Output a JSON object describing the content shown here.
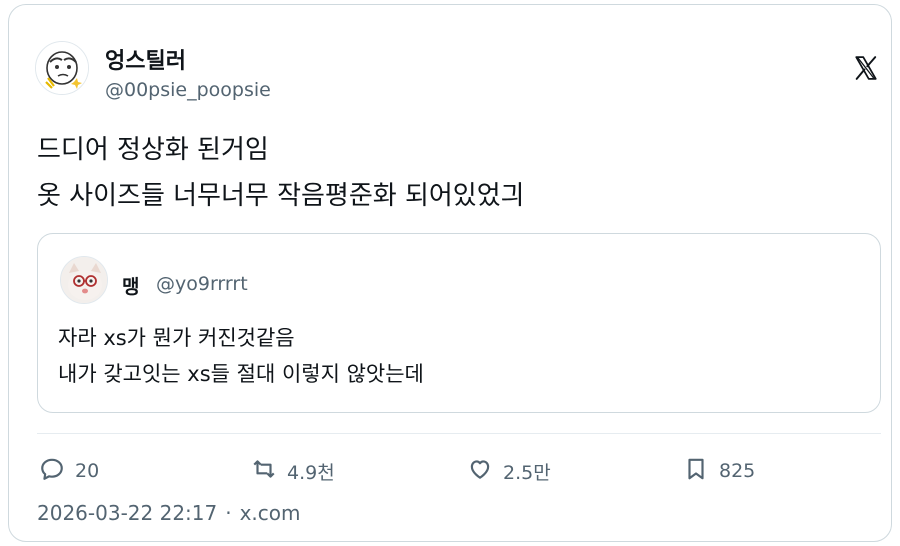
{
  "author": {
    "name": "엉스틸러",
    "handle": "@00psie_poopsie"
  },
  "tweet": {
    "lines": [
      "드디어 정상화 된거임",
      "옷 사이즈들 너무너무 작음평준화 되어있었긔"
    ]
  },
  "quoted": {
    "name": "맹",
    "handle": "@yo9rrrrt",
    "lines": [
      "자라 xs가 뭔가 커진것같음",
      "내가 갖고잇는 xs들 절대 이렇지 않앗는데"
    ]
  },
  "actions": {
    "replies": "20",
    "retweets": "4.9천",
    "likes": "2.5만",
    "bookmarks": "825"
  },
  "meta": {
    "timestamp": "2026-03-22 22:17",
    "separator": "·",
    "source": "x.com"
  },
  "icons": [
    "avatar",
    "x-logo-icon",
    "reply-icon",
    "retweet-icon",
    "like-icon",
    "bookmark-icon"
  ],
  "colors": {
    "text": "#0f1419",
    "secondary": "#536471",
    "border": "#cfd9de"
  }
}
